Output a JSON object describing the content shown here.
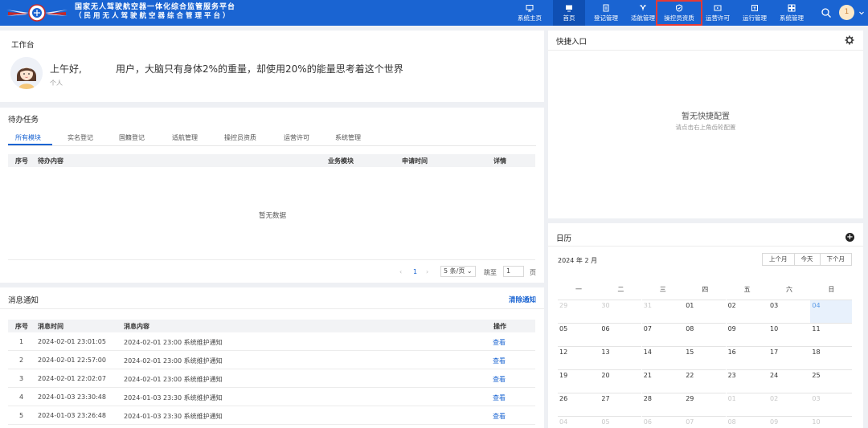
{
  "header": {
    "title_line1": "国家无人驾驶航空器一体化综合监管服务平台",
    "title_line2": "（民用无人驾驶航空器综合管理平台）",
    "nav": [
      {
        "label": "系统主页",
        "icon": "screen-icon"
      },
      {
        "label": "首页",
        "icon": "monitor-icon",
        "active": true
      },
      {
        "label": "登记管理",
        "icon": "register-icon"
      },
      {
        "label": "适航管理",
        "icon": "drone-icon"
      },
      {
        "label": "操控员资质",
        "icon": "shield-icon",
        "highlighted": true
      },
      {
        "label": "运营许可",
        "icon": "permit-icon"
      },
      {
        "label": "运行管理",
        "icon": "ops-icon"
      },
      {
        "label": "系统管理",
        "icon": "system-icon"
      }
    ],
    "user_badge": "1",
    "colors": {
      "brand": "#1a64d2",
      "highlight": "#e53935"
    }
  },
  "workbench": {
    "title": "工作台",
    "greeting": "上午好,",
    "message": "用户，大脑只有身体2%的重量，却使用20%的能量思考着这个世界",
    "role": "个人"
  },
  "todo": {
    "title": "待办任务",
    "tabs": [
      "所有模块",
      "实名登记",
      "国籍登记",
      "适航管理",
      "操控员资质",
      "运营许可",
      "系统管理"
    ],
    "columns": [
      "序号",
      "待办内容",
      "业务模块",
      "申请时间",
      "详情"
    ],
    "empty_text": "暂无数据",
    "pagination": {
      "current_page": "1",
      "page_size": "5 条/页",
      "jump_label": "跳至",
      "jump_value": "1",
      "page_suffix": "页"
    }
  },
  "notice": {
    "title": "消息通知",
    "clear_label": "清除通知",
    "columns": [
      "序号",
      "消息时间",
      "消息内容",
      "操作"
    ],
    "rows": [
      {
        "no": "1",
        "time": "2024-02-01 23:01:05",
        "content": "2024-02-01 23:00 系统维护通知",
        "action": "查看"
      },
      {
        "no": "2",
        "time": "2024-02-01 22:57:00",
        "content": "2024-02-01 23:00 系统维护通知",
        "action": "查看"
      },
      {
        "no": "3",
        "time": "2024-02-01 22:02:07",
        "content": "2024-02-01 23:00 系统维护通知",
        "action": "查看"
      },
      {
        "no": "4",
        "time": "2024-01-03 23:30:48",
        "content": "2024-01-03 23:30 系统维护通知",
        "action": "查看"
      },
      {
        "no": "5",
        "time": "2024-01-03 23:26:48",
        "content": "2024-01-03 23:30 系统维护通知",
        "action": "查看"
      }
    ]
  },
  "quick": {
    "title": "快捷入口",
    "empty_title": "暂无快捷配置",
    "empty_hint": "请点击右上角齿轮配置"
  },
  "calendar": {
    "title": "日历",
    "month_label": "2024 年 2 月",
    "buttons": [
      "上个月",
      "今天",
      "下个月"
    ],
    "weekdays": [
      "一",
      "二",
      "三",
      "四",
      "五",
      "六",
      "日"
    ],
    "weeks": [
      [
        {
          "d": "29",
          "dim": true
        },
        {
          "d": "30",
          "dim": true
        },
        {
          "d": "31",
          "dim": true
        },
        {
          "d": "01"
        },
        {
          "d": "02"
        },
        {
          "d": "03"
        },
        {
          "d": "04",
          "today": true
        }
      ],
      [
        {
          "d": "05"
        },
        {
          "d": "06"
        },
        {
          "d": "07"
        },
        {
          "d": "08"
        },
        {
          "d": "09"
        },
        {
          "d": "10"
        },
        {
          "d": "11"
        }
      ],
      [
        {
          "d": "12"
        },
        {
          "d": "13"
        },
        {
          "d": "14"
        },
        {
          "d": "15"
        },
        {
          "d": "16"
        },
        {
          "d": "17"
        },
        {
          "d": "18"
        }
      ],
      [
        {
          "d": "19"
        },
        {
          "d": "20"
        },
        {
          "d": "21"
        },
        {
          "d": "22"
        },
        {
          "d": "23"
        },
        {
          "d": "24"
        },
        {
          "d": "25"
        }
      ],
      [
        {
          "d": "26"
        },
        {
          "d": "27"
        },
        {
          "d": "28"
        },
        {
          "d": "29"
        },
        {
          "d": "01",
          "dim": true
        },
        {
          "d": "02",
          "dim": true
        },
        {
          "d": "03",
          "dim": true
        }
      ],
      [
        {
          "d": "04",
          "dim": true
        },
        {
          "d": "05",
          "dim": true
        },
        {
          "d": "06",
          "dim": true
        },
        {
          "d": "07",
          "dim": true
        },
        {
          "d": "08",
          "dim": true
        },
        {
          "d": "09",
          "dim": true
        },
        {
          "d": "10",
          "dim": true
        }
      ]
    ]
  }
}
